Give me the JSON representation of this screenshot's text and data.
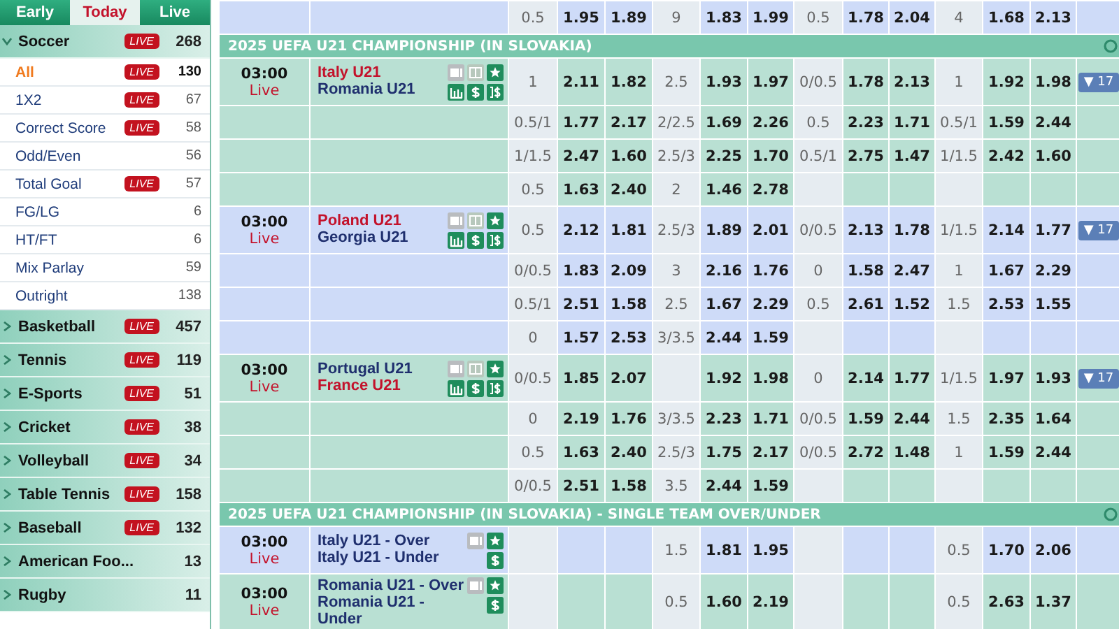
{
  "sidebar": {
    "tabs": [
      {
        "label": "Early",
        "selected": false
      },
      {
        "label": "Today",
        "selected": true
      },
      {
        "label": "Live",
        "selected": false
      }
    ],
    "sports": [
      {
        "name": "Soccer",
        "badge": "LIVE",
        "count": "268",
        "expanded": true,
        "children": [
          {
            "name": "All",
            "badge": "LIVE",
            "count": "130",
            "selected": true
          },
          {
            "name": "1X2",
            "badge": "LIVE",
            "count": "67",
            "selected": false
          },
          {
            "name": "Correct Score",
            "badge": "LIVE",
            "count": "58",
            "selected": false
          },
          {
            "name": "Odd/Even",
            "count": "56",
            "selected": false
          },
          {
            "name": "Total Goal",
            "badge": "LIVE",
            "count": "57",
            "selected": false
          },
          {
            "name": "FG/LG",
            "count": "6",
            "selected": false
          },
          {
            "name": "HT/FT",
            "count": "6",
            "selected": false
          },
          {
            "name": "Mix Parlay",
            "count": "59",
            "selected": false
          },
          {
            "name": "Outright",
            "count": "138",
            "selected": false
          }
        ]
      },
      {
        "name": "Basketball",
        "badge": "LIVE",
        "count": "457",
        "expanded": false
      },
      {
        "name": "Tennis",
        "badge": "LIVE",
        "count": "119",
        "expanded": false
      },
      {
        "name": "E-Sports",
        "badge": "LIVE",
        "count": "51",
        "expanded": false
      },
      {
        "name": "Cricket",
        "badge": "LIVE",
        "count": "38",
        "expanded": false
      },
      {
        "name": "Volleyball",
        "badge": "LIVE",
        "count": "34",
        "expanded": false
      },
      {
        "name": "Table Tennis",
        "badge": "LIVE",
        "count": "158",
        "expanded": false
      },
      {
        "name": "Baseball",
        "badge": "LIVE",
        "count": "132",
        "expanded": false
      },
      {
        "name": "American Foo...",
        "count": "13",
        "expanded": false
      },
      {
        "name": "Rugby",
        "count": "11",
        "expanded": false
      }
    ]
  },
  "sections": [
    {
      "matches": [
        {
          "lines": [
            {
              "ft_hdp": "0.5",
              "ft_home": "1.95",
              "ft_away": "1.89",
              "ft_ou": "9",
              "ft_over": "1.83",
              "ft_under": "1.99",
              "h1_hdp": "0.5",
              "h1_home": "1.78",
              "h1_away": "2.04",
              "h1_ou": "4",
              "h1_over": "1.68",
              "h1_under": "2.13"
            }
          ]
        }
      ]
    },
    {
      "title": "2025 UEFA U21 CHAMPIONSHIP (IN SLOVAKIA)",
      "matches": [
        {
          "kind": "handicap",
          "time": "03:00",
          "status": "Live",
          "teams": [
            {
              "name": "Italy U21",
              "favorite": true
            },
            {
              "name": "Romania U21",
              "favorite": false
            }
          ],
          "more": "▼ 17",
          "lines": [
            {
              "ft_hdp": "1",
              "ft_home": "2.11",
              "ft_away": "1.82",
              "ft_ou": "2.5",
              "ft_over": "1.93",
              "ft_under": "1.97",
              "h1_hdp": "0/0.5",
              "h1_home": "1.78",
              "h1_away": "2.13",
              "h1_ou": "1",
              "h1_over": "1.92",
              "h1_under": "1.98"
            },
            {
              "ft_hdp": "0.5/1",
              "ft_home": "1.77",
              "ft_away": "2.17",
              "ft_ou": "2/2.5",
              "ft_over": "1.69",
              "ft_under": "2.26",
              "h1_hdp": "0.5",
              "h1_home": "2.23",
              "h1_away": "1.71",
              "h1_ou": "0.5/1",
              "h1_over": "1.59",
              "h1_under": "2.44"
            },
            {
              "ft_hdp": "1/1.5",
              "ft_home": "2.47",
              "ft_away": "1.60",
              "ft_ou": "2.5/3",
              "ft_over": "2.25",
              "ft_under": "1.70",
              "h1_hdp": "0.5/1",
              "h1_home": "2.75",
              "h1_away": "1.47",
              "h1_ou": "1/1.5",
              "h1_over": "2.42",
              "h1_under": "1.60"
            },
            {
              "ft_hdp": "0.5",
              "ft_home": "1.63",
              "ft_away": "2.40",
              "ft_ou": "2",
              "ft_over": "1.46",
              "ft_under": "2.78"
            }
          ]
        },
        {
          "kind": "handicap",
          "time": "03:00",
          "status": "Live",
          "teams": [
            {
              "name": "Poland U21",
              "favorite": true
            },
            {
              "name": "Georgia U21",
              "favorite": false
            }
          ],
          "more": "▼ 17",
          "lines": [
            {
              "ft_hdp": "0.5",
              "ft_home": "2.12",
              "ft_away": "1.81",
              "ft_ou": "2.5/3",
              "ft_over": "1.89",
              "ft_under": "2.01",
              "h1_hdp": "0/0.5",
              "h1_home": "2.13",
              "h1_away": "1.78",
              "h1_ou": "1/1.5",
              "h1_over": "2.14",
              "h1_under": "1.77"
            },
            {
              "ft_hdp": "0/0.5",
              "ft_home": "1.83",
              "ft_away": "2.09",
              "ft_ou": "3",
              "ft_over": "2.16",
              "ft_under": "1.76",
              "h1_hdp": "0",
              "h1_home": "1.58",
              "h1_away": "2.47",
              "h1_ou": "1",
              "h1_over": "1.67",
              "h1_under": "2.29"
            },
            {
              "ft_hdp": "0.5/1",
              "ft_home": "2.51",
              "ft_away": "1.58",
              "ft_ou": "2.5",
              "ft_over": "1.67",
              "ft_under": "2.29",
              "h1_hdp": "0.5",
              "h1_home": "2.61",
              "h1_away": "1.52",
              "h1_ou": "1.5",
              "h1_over": "2.53",
              "h1_under": "1.55"
            },
            {
              "ft_hdp": "0",
              "ft_home": "1.57",
              "ft_away": "2.53",
              "ft_ou": "3/3.5",
              "ft_over": "2.44",
              "ft_under": "1.59"
            }
          ]
        },
        {
          "kind": "handicap",
          "time": "03:00",
          "status": "Live",
          "teams": [
            {
              "name": "Portugal U21",
              "favorite": false
            },
            {
              "name": "France U21",
              "favorite": true
            }
          ],
          "more": "▼ 17",
          "lines": [
            {
              "ft_hdp": "0/0.5",
              "ft_home": "1.85",
              "ft_away": "2.07",
              "ft_over": "1.92",
              "ft_under": "1.98",
              "h1_hdp": "0",
              "h1_home": "2.14",
              "h1_away": "1.77",
              "h1_ou": "1/1.5",
              "h1_over": "1.97",
              "h1_under": "1.93"
            },
            {
              "ft_hdp": "0",
              "ft_home": "2.19",
              "ft_away": "1.76",
              "ft_ou": "3/3.5",
              "ft_over": "2.23",
              "ft_under": "1.71",
              "h1_hdp": "0/0.5",
              "h1_home": "1.59",
              "h1_away": "2.44",
              "h1_ou": "1.5",
              "h1_over": "2.35",
              "h1_under": "1.64"
            },
            {
              "ft_hdp": "0.5",
              "ft_home": "1.63",
              "ft_away": "2.40",
              "ft_ou": "2.5/3",
              "ft_over": "1.75",
              "ft_under": "2.17",
              "h1_hdp": "0/0.5",
              "h1_home": "2.72",
              "h1_away": "1.48",
              "h1_ou": "1",
              "h1_over": "1.59",
              "h1_under": "2.44"
            },
            {
              "ft_hdp": "0/0.5",
              "ft_home": "2.51",
              "ft_away": "1.58",
              "ft_ou": "3.5",
              "ft_over": "2.44",
              "ft_under": "1.59"
            }
          ]
        }
      ]
    },
    {
      "title": "2025 UEFA U21 CHAMPIONSHIP (IN SLOVAKIA) - SINGLE TEAM OVER/UNDER",
      "matches": [
        {
          "kind": "team_total",
          "time": "03:00",
          "status": "Live",
          "teams": [
            {
              "name": "Italy U21 - Over",
              "favorite": false
            },
            {
              "name": "Italy U21 - Under",
              "favorite": false
            }
          ],
          "lines": [
            {
              "ft_ou": "1.5",
              "ft_over": "1.81",
              "ft_under": "1.95",
              "h1_ou": "0.5",
              "h1_over": "1.70",
              "h1_under": "2.06"
            }
          ]
        },
        {
          "kind": "team_total",
          "time": "03:00",
          "status": "Live",
          "teams": [
            {
              "name": "Romania U21 - Over",
              "favorite": false
            },
            {
              "name": "Romania U21 - Under",
              "favorite": false
            }
          ],
          "lines": [
            {
              "ft_ou": "0.5",
              "ft_over": "1.60",
              "ft_under": "2.19",
              "h1_ou": "0.5",
              "h1_over": "2.63",
              "h1_under": "1.37"
            }
          ]
        }
      ]
    }
  ]
}
